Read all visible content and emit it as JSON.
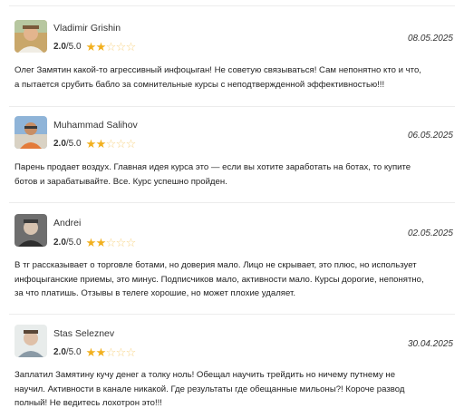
{
  "reviews": [
    {
      "author": "Vladimir Grishin",
      "rating_value": "2.0",
      "rating_max": "/5.0",
      "stars_filled": 2,
      "stars_total": 5,
      "date": "08.05.2025",
      "text_lines": [
        "Олег Замятин какой-то агрессивный инфоцыган! Не советую связываться! Сам непонятно кто и что,",
        "а пытается срубить бабло за сомнительные курсы с неподтвержденной эффективностью!!!"
      ]
    },
    {
      "author": "Muhammad Salihov",
      "rating_value": "2.0",
      "rating_max": "/5.0",
      "stars_filled": 2,
      "stars_total": 5,
      "date": "06.05.2025",
      "text_lines": [
        "Парень продает воздух. Главная идея курса это — если вы хотите заработать на ботах, то купите",
        "ботов и зарабатывайте. Все. Курс успешно пройден."
      ]
    },
    {
      "author": "Andrei",
      "rating_value": "2.0",
      "rating_max": "/5.0",
      "stars_filled": 2,
      "stars_total": 5,
      "date": "02.05.2025",
      "text_lines": [
        "В тг рассказывает о торговле ботами, но доверия мало. Лицо не скрывает, это плюс, но использует",
        "инфоцыганские приемы, это минус. Подписчиков мало, активности мало. Курсы дорогие, непонятно,",
        "за что платишь. Отзывы в телеге хорошие, но может плохие удаляет."
      ]
    },
    {
      "author": "Stas Seleznev",
      "rating_value": "2.0",
      "rating_max": "/5.0",
      "stars_filled": 2,
      "stars_total": 5,
      "date": "30.04.2025",
      "text_lines": [
        "Заплатил Замятину кучу денег а толку ноль! Обещал научить трейдить но ничему путнему не",
        "научил. Активности в канале никакой. Где результаты где обещанные мильоны?! Короче развод",
        "полный! Не ведитесь лохотрон это!!!"
      ]
    }
  ],
  "colors": {
    "star": "#f2b01e",
    "divider": "#ececec",
    "text": "#222222"
  },
  "icons": {
    "avatar": "user-avatar-photo",
    "star_full": "star-filled-icon",
    "star_empty": "star-outline-icon"
  }
}
